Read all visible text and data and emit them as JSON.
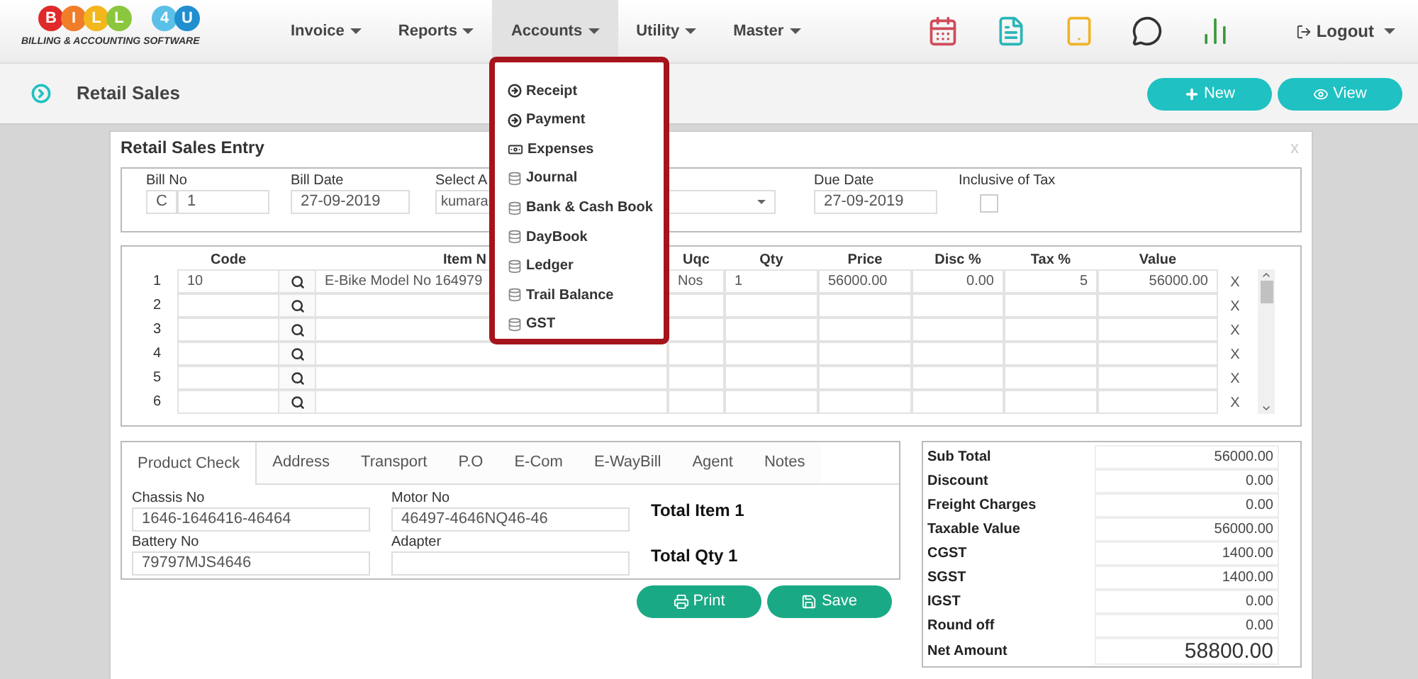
{
  "logo": {
    "letters": [
      {
        "text": "B",
        "color": "#e02a2a"
      },
      {
        "text": "I",
        "color": "#f07d2a"
      },
      {
        "text": "L",
        "color": "#f2b71c"
      },
      {
        "text": "L",
        "color": "#8cc63f"
      },
      {
        "text": "4",
        "color": "#5bc0e8"
      },
      {
        "text": "U",
        "color": "#1f8fd0"
      }
    ],
    "tagline": "BILLING & ACCOUNTING SOFTWARE"
  },
  "nav": [
    {
      "label": "Invoice",
      "selected": false
    },
    {
      "label": "Reports",
      "selected": false
    },
    {
      "label": "Accounts",
      "selected": true
    },
    {
      "label": "Utility",
      "selected": false
    },
    {
      "label": "Master",
      "selected": false
    }
  ],
  "logout": {
    "label": "Logout"
  },
  "page": {
    "title": "Retail Sales",
    "actions": [
      {
        "label": "New",
        "kind": "add"
      },
      {
        "label": "View",
        "kind": "view"
      }
    ]
  },
  "accounts_menu": [
    {
      "label": "Receipt",
      "kind": "circle"
    },
    {
      "label": "Payment",
      "kind": "circle"
    },
    {
      "label": "Expenses",
      "kind": "cash"
    },
    {
      "label": "Journal",
      "kind": "stack"
    },
    {
      "label": "Bank & Cash Book",
      "kind": "stack"
    },
    {
      "label": "DayBook",
      "kind": "stack"
    },
    {
      "label": "Ledger",
      "kind": "stack"
    },
    {
      "label": "Trail Balance",
      "kind": "stack"
    },
    {
      "label": "GST",
      "kind": "stack"
    }
  ],
  "entry": {
    "title": "Retail Sales Entry",
    "close": "x",
    "bill_no": {
      "label": "Bill No",
      "prefix": "C",
      "value": "1"
    },
    "bill_date": {
      "label": "Bill Date",
      "value": "27-09-2019"
    },
    "account": {
      "label": "Select A",
      "value": "kumara"
    },
    "due_date": {
      "label": "Due Date",
      "value": "27-09-2019"
    },
    "inclusive_tax": {
      "label": "Inclusive of Tax",
      "checked": false
    }
  },
  "grid": {
    "columns": [
      "Code",
      "Item N",
      "Uqc",
      "Qty",
      "Price",
      "Disc %",
      "Tax %",
      "Value"
    ],
    "rows": [
      {
        "number": "1",
        "code": "10",
        "item": "E-Bike Model No 164979",
        "uqc": "Nos",
        "qty": "1",
        "price": "56000.00",
        "disc": "0.00",
        "tax": "5",
        "value": "56000.00",
        "remove": "X"
      },
      {
        "number": "2",
        "remove": "X"
      },
      {
        "number": "3",
        "remove": "X"
      },
      {
        "number": "4",
        "remove": "X"
      },
      {
        "number": "5",
        "remove": "X"
      },
      {
        "number": "6",
        "remove": "X"
      }
    ]
  },
  "tabs": [
    {
      "label": "Product Check",
      "selected": true
    },
    {
      "label": "Address",
      "selected": false
    },
    {
      "label": "Transport",
      "selected": false
    },
    {
      "label": "P.O",
      "selected": false
    },
    {
      "label": "E-Com",
      "selected": false
    },
    {
      "label": "E-WayBill",
      "selected": false
    },
    {
      "label": "Agent",
      "selected": false
    },
    {
      "label": "Notes",
      "selected": false
    }
  ],
  "product_fields": [
    {
      "label": "Chassis No",
      "value": "1646-1646416-46464"
    },
    {
      "label": "Motor No",
      "value": "46497-4646NQ46-46"
    },
    {
      "label": "Battery No",
      "value": "79797MJS4646"
    },
    {
      "label": "Adapter"
    }
  ],
  "totals": [
    "Total Item 1",
    "Total Qty 1"
  ],
  "buttons": [
    {
      "label": "Print",
      "kind": "print"
    },
    {
      "label": "Save",
      "kind": "save"
    }
  ],
  "summary": [
    {
      "label": "Sub Total",
      "value": "56000.00",
      "kind": "line"
    },
    {
      "label": "Discount",
      "value": "0.00",
      "kind": "line"
    },
    {
      "label": "Freight Charges",
      "value": "0.00",
      "kind": "line"
    },
    {
      "label": "Taxable Value",
      "value": "56000.00",
      "kind": "line"
    },
    {
      "label": "CGST",
      "value": "1400.00",
      "kind": "line"
    },
    {
      "label": "SGST",
      "value": "1400.00",
      "kind": "line"
    },
    {
      "label": "IGST",
      "value": "0.00",
      "kind": "line"
    },
    {
      "label": "Round off",
      "value": "0.00",
      "kind": "line"
    },
    {
      "label": "Net Amount",
      "value": "58800.00",
      "kind": "grand"
    }
  ]
}
